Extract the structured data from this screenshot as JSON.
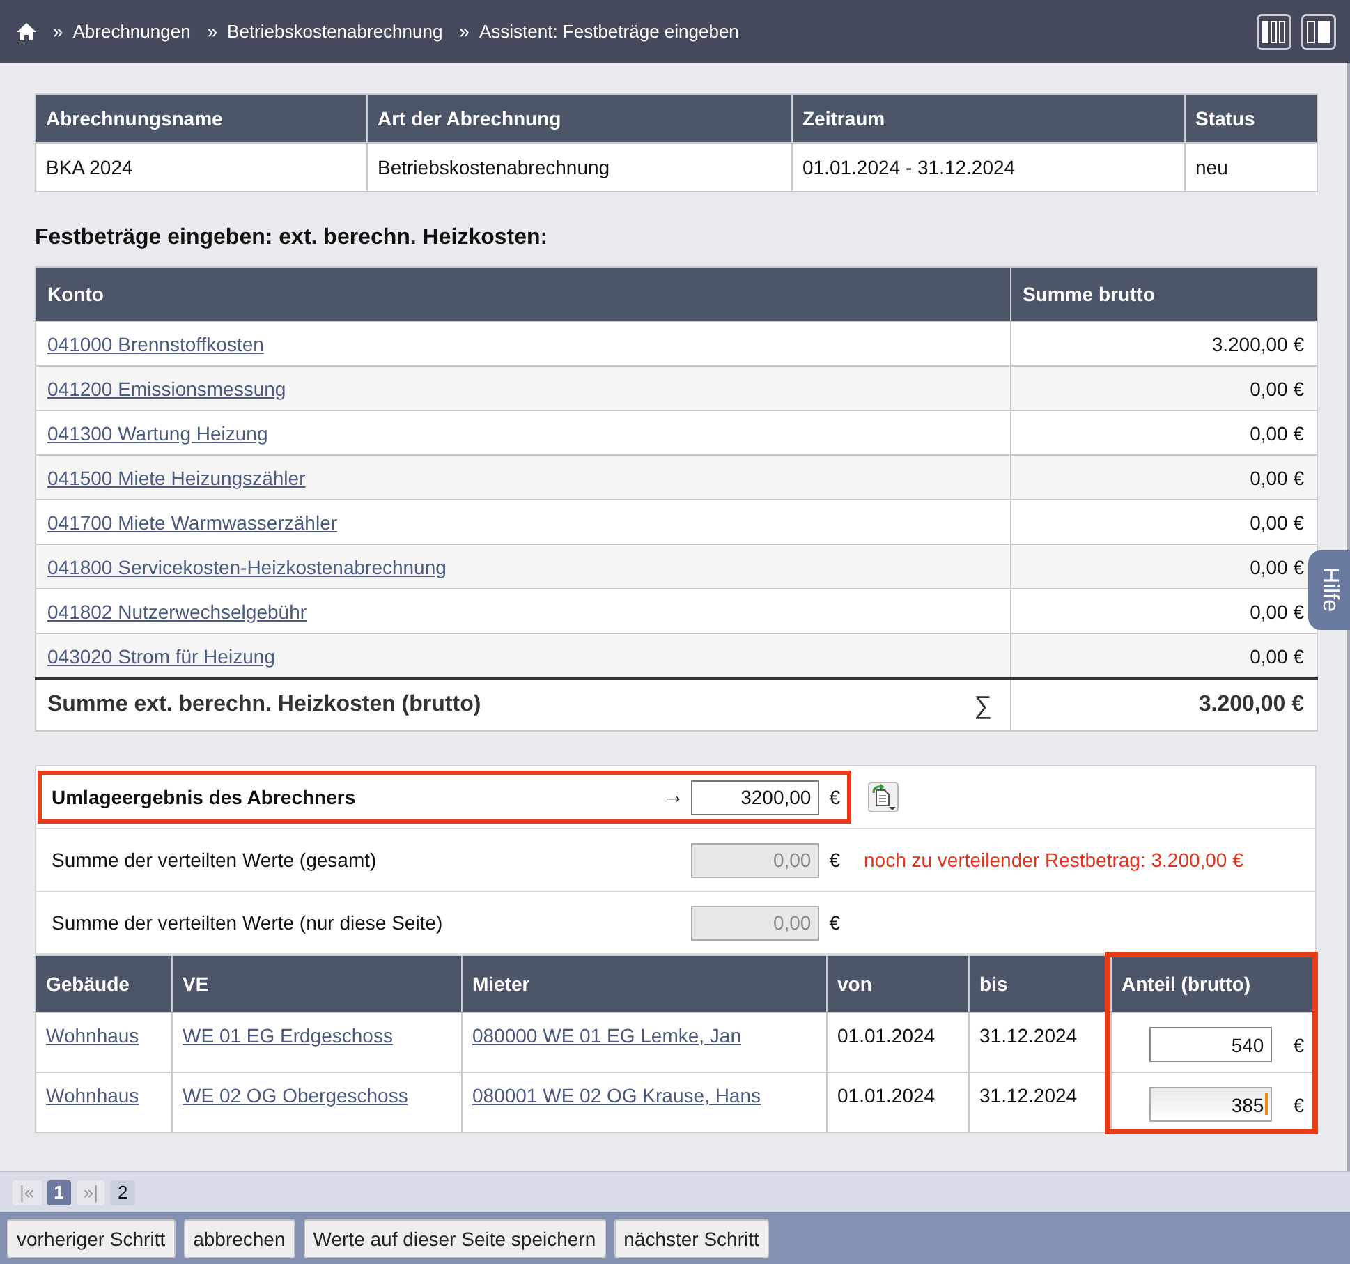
{
  "breadcrumb": {
    "separator": "»",
    "items": [
      "Abrechnungen",
      "Betriebskostenabrechnung",
      "Assistent: Festbeträge eingeben"
    ]
  },
  "summary_table": {
    "columns": [
      "Abrechnungsname",
      "Art der Abrechnung",
      "Zeitraum",
      "Status"
    ],
    "rows": [
      [
        "BKA 2024",
        "Betriebskostenabrechnung",
        "01.01.2024 - 31.12.2024",
        "neu"
      ]
    ]
  },
  "section_title": "Festbeträge eingeben: ext. berechn. Heizkosten:",
  "accounts_table": {
    "columns": [
      "Konto",
      "Summe brutto"
    ],
    "rows": [
      {
        "account": "041000 Brennstoffkosten",
        "amount": "3.200,00 €"
      },
      {
        "account": "041200 Emissionsmessung",
        "amount": "0,00 €"
      },
      {
        "account": "041300 Wartung Heizung",
        "amount": "0,00 €"
      },
      {
        "account": "041500 Miete Heizungszähler",
        "amount": "0,00 €"
      },
      {
        "account": "041700 Miete Warmwasserzähler",
        "amount": "0,00 €"
      },
      {
        "account": "041800 Servicekosten-Heizkostenabrechnung",
        "amount": "0,00 €"
      },
      {
        "account": "041802 Nutzerwechselgebühr",
        "amount": "0,00 €"
      },
      {
        "account": "043020 Strom für Heizung",
        "amount": "0,00 €"
      }
    ],
    "total": {
      "label": "Summe ext. berechn. Heizkosten (brutto)",
      "symbol": "∑",
      "amount": "3.200,00 €"
    }
  },
  "distribution": {
    "rows": [
      {
        "kind": "result",
        "label": "Umlageergebnis des Abrechners",
        "arrow": "→",
        "value": "3200,00",
        "currency": "€",
        "disabled": false,
        "highlighted": true
      },
      {
        "kind": "sum",
        "label": "Summe der verteilten Werte (gesamt)",
        "value": "0,00",
        "currency": "€",
        "disabled": true,
        "highlighted": false,
        "note": "noch zu verteilender Restbetrag: 3.200,00 €"
      },
      {
        "kind": "sum",
        "label": "Summe der verteilten Werte (nur diese Seite)",
        "value": "0,00",
        "currency": "€",
        "disabled": true,
        "highlighted": false
      }
    ]
  },
  "tenants_table": {
    "columns": [
      {
        "label": "Gebäude",
        "highlighted": false
      },
      {
        "label": "VE",
        "highlighted": false
      },
      {
        "label": "Mieter",
        "highlighted": false
      },
      {
        "label": "von",
        "highlighted": false
      },
      {
        "label": "bis",
        "highlighted": false
      },
      {
        "label": "Anteil (brutto)",
        "highlighted": true
      }
    ],
    "rows": [
      {
        "building": "Wohnhaus",
        "unit": "WE 01 EG Erdgeschoss",
        "tenant": "080000 WE 01 EG Lemke, Jan",
        "from": "01.01.2024",
        "to": "31.12.2024",
        "share": "540",
        "currency": "€",
        "focused": false
      },
      {
        "building": "Wohnhaus",
        "unit": "WE 02 OG Obergeschoss",
        "tenant": "080001 WE 02 OG Krause, Hans",
        "from": "01.01.2024",
        "to": "31.12.2024",
        "share": "385",
        "currency": "€",
        "focused": true
      }
    ]
  },
  "pager": [
    {
      "kind": "nav",
      "label": "|«",
      "disabled": true
    },
    {
      "kind": "page",
      "label": "1",
      "selected": true
    },
    {
      "kind": "nav",
      "label": "»|",
      "disabled": true
    },
    {
      "kind": "page",
      "label": "2",
      "selected": false
    }
  ],
  "buttons": [
    "vorheriger Schritt",
    "abbrechen",
    "Werte auf dieser Seite speichern",
    "nächster Schritt"
  ],
  "help_tab": "Hilfe"
}
